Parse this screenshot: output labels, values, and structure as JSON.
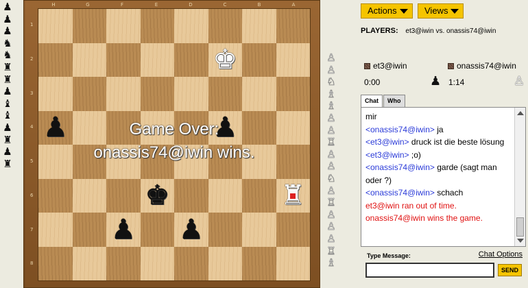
{
  "captured_by_white": [
    "♟",
    "♟",
    "♟",
    "♞",
    "♞",
    "♜",
    "♜",
    "♟",
    "♝",
    "♝",
    "♟",
    "♜",
    "♟",
    "♜"
  ],
  "captured_by_black": [
    "♙",
    "♙",
    "♘",
    "♗",
    "♗",
    "♙",
    "♙",
    "♖",
    "♙",
    "♙",
    "♘",
    "♙",
    "♖",
    "♙",
    "♙",
    "♙",
    "♖",
    "♗"
  ],
  "board": {
    "file_labels": [
      "H",
      "G",
      "F",
      "E",
      "D",
      "C",
      "B",
      "A"
    ],
    "rank_labels": [
      "1",
      "2",
      "3",
      "4",
      "5",
      "6",
      "7",
      "8"
    ],
    "rows": [
      [
        null,
        null,
        null,
        null,
        null,
        null,
        null,
        null
      ],
      [
        null,
        null,
        null,
        null,
        null,
        {
          "g": "♚",
          "c": "white"
        },
        null,
        null
      ],
      [
        null,
        null,
        null,
        null,
        null,
        null,
        null,
        null
      ],
      [
        {
          "g": "♟",
          "c": "black"
        },
        null,
        null,
        null,
        null,
        {
          "g": "♟",
          "c": "black"
        },
        null,
        null
      ],
      [
        null,
        null,
        null,
        null,
        null,
        null,
        null,
        null
      ],
      [
        null,
        null,
        null,
        {
          "g": "♚",
          "c": "black"
        },
        null,
        null,
        null,
        {
          "g": "♜",
          "c": "white",
          "marker": true
        }
      ],
      [
        null,
        null,
        {
          "g": "♟",
          "c": "black"
        },
        null,
        {
          "g": "♟",
          "c": "black"
        },
        null,
        null,
        null
      ],
      [
        null,
        null,
        null,
        null,
        null,
        null,
        null,
        null
      ]
    ]
  },
  "overlay": {
    "line1": "Game Over:",
    "line2": "onassis74@iwin wins."
  },
  "toolbar": {
    "actions_label": "Actions",
    "views_label": "Views"
  },
  "players": {
    "heading": "PLAYERS:",
    "matchup": "et3@iwin vs. onassis74@iwin",
    "left_name": "et3@iwin",
    "right_name": "onassis74@iwin",
    "left_clock": "0:00",
    "right_clock": "1:14",
    "turn_icon": "♟",
    "observer_icon": "♙"
  },
  "tabs": [
    {
      "label": "Chat"
    },
    {
      "label": "Who"
    }
  ],
  "chat": {
    "lines": [
      {
        "who": "",
        "text": "mir",
        "type": "normal"
      },
      {
        "who": "<onassis74@iwin>",
        "text": " ja",
        "type": "normal"
      },
      {
        "who": "<et3@iwin>",
        "text": " druck ist die beste lösung",
        "type": "normal"
      },
      {
        "who": "<et3@iwin>",
        "text": " ;o)",
        "type": "normal"
      },
      {
        "who": "<onassis74@iwin>",
        "text": " garde (sagt man oder ?)",
        "type": "normal"
      },
      {
        "who": "<onassis74@iwin>",
        "text": " schach",
        "type": "normal"
      },
      {
        "who": "",
        "text": "et3@iwin ran out of time.",
        "type": "system"
      },
      {
        "who": "",
        "text": "onassis74@iwin wins the game.",
        "type": "system"
      }
    ],
    "type_label": "Type Message:",
    "options_label": "Chat Options",
    "input_value": "",
    "send_label": "SEND"
  },
  "colors": {
    "button_yellow": "#f5c400",
    "system_red": "#e01010",
    "name_blue": "#2a3ad8"
  }
}
